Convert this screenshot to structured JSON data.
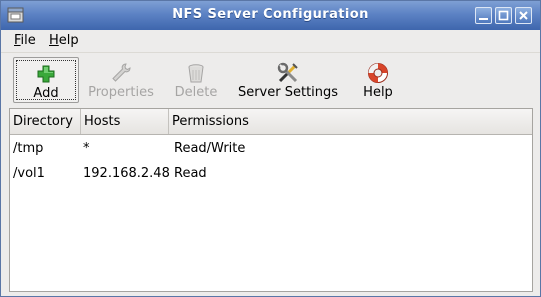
{
  "window": {
    "title": "NFS Server Configuration",
    "controls": [
      "minimize",
      "maximize",
      "close"
    ]
  },
  "menu": {
    "items": [
      {
        "label": "File",
        "mnemonic": "F",
        "rest": "ile"
      },
      {
        "label": "Help",
        "mnemonic": "H",
        "rest": "elp"
      }
    ]
  },
  "toolbar": {
    "buttons": [
      {
        "label": "Add",
        "icon": "add-plus-icon",
        "enabled": true,
        "focused": true
      },
      {
        "label": "Properties",
        "icon": "wrench-icon",
        "enabled": false
      },
      {
        "label": "Delete",
        "icon": "trash-can-icon",
        "enabled": false
      },
      {
        "label": "Server Settings",
        "icon": "tools-screwdriver-wrench-icon",
        "enabled": true
      },
      {
        "label": "Help",
        "icon": "lifebuoy-icon",
        "enabled": true
      }
    ]
  },
  "table": {
    "columns": [
      "Directory",
      "Hosts",
      "Permissions"
    ],
    "rows": [
      {
        "directory": "/tmp",
        "hosts": "*",
        "permissions": "Read/Write"
      },
      {
        "directory": "/vol1",
        "hosts": "192.168.2.48",
        "permissions": "Read"
      }
    ]
  },
  "colors": {
    "titlebar": "#5c82c4",
    "window_bg": "#edeceb",
    "disabled_text": "#a6a5a4"
  }
}
